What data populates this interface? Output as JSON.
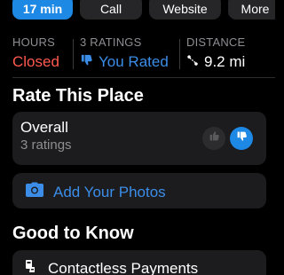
{
  "actions": {
    "primary_label": "17 min",
    "call_label": "Call",
    "website_label": "Website",
    "more_label": "More"
  },
  "stats": {
    "hours_label": "HOURS",
    "hours_value": "Closed",
    "ratings_label": "3 RATINGS",
    "ratings_value": "You Rated",
    "distance_label": "DISTANCE",
    "distance_value": "9.2 mi"
  },
  "rate_section": {
    "title": "Rate This Place",
    "overall_label": "Overall",
    "overall_count": "3 ratings"
  },
  "photos": {
    "label": "Add Your Photos"
  },
  "good_to_know": {
    "title": "Good to Know",
    "item_label": "Contactless Payments"
  },
  "colors": {
    "accent": "#1e88e5",
    "closed": "#ff5a4f",
    "link": "#3b8de8"
  }
}
